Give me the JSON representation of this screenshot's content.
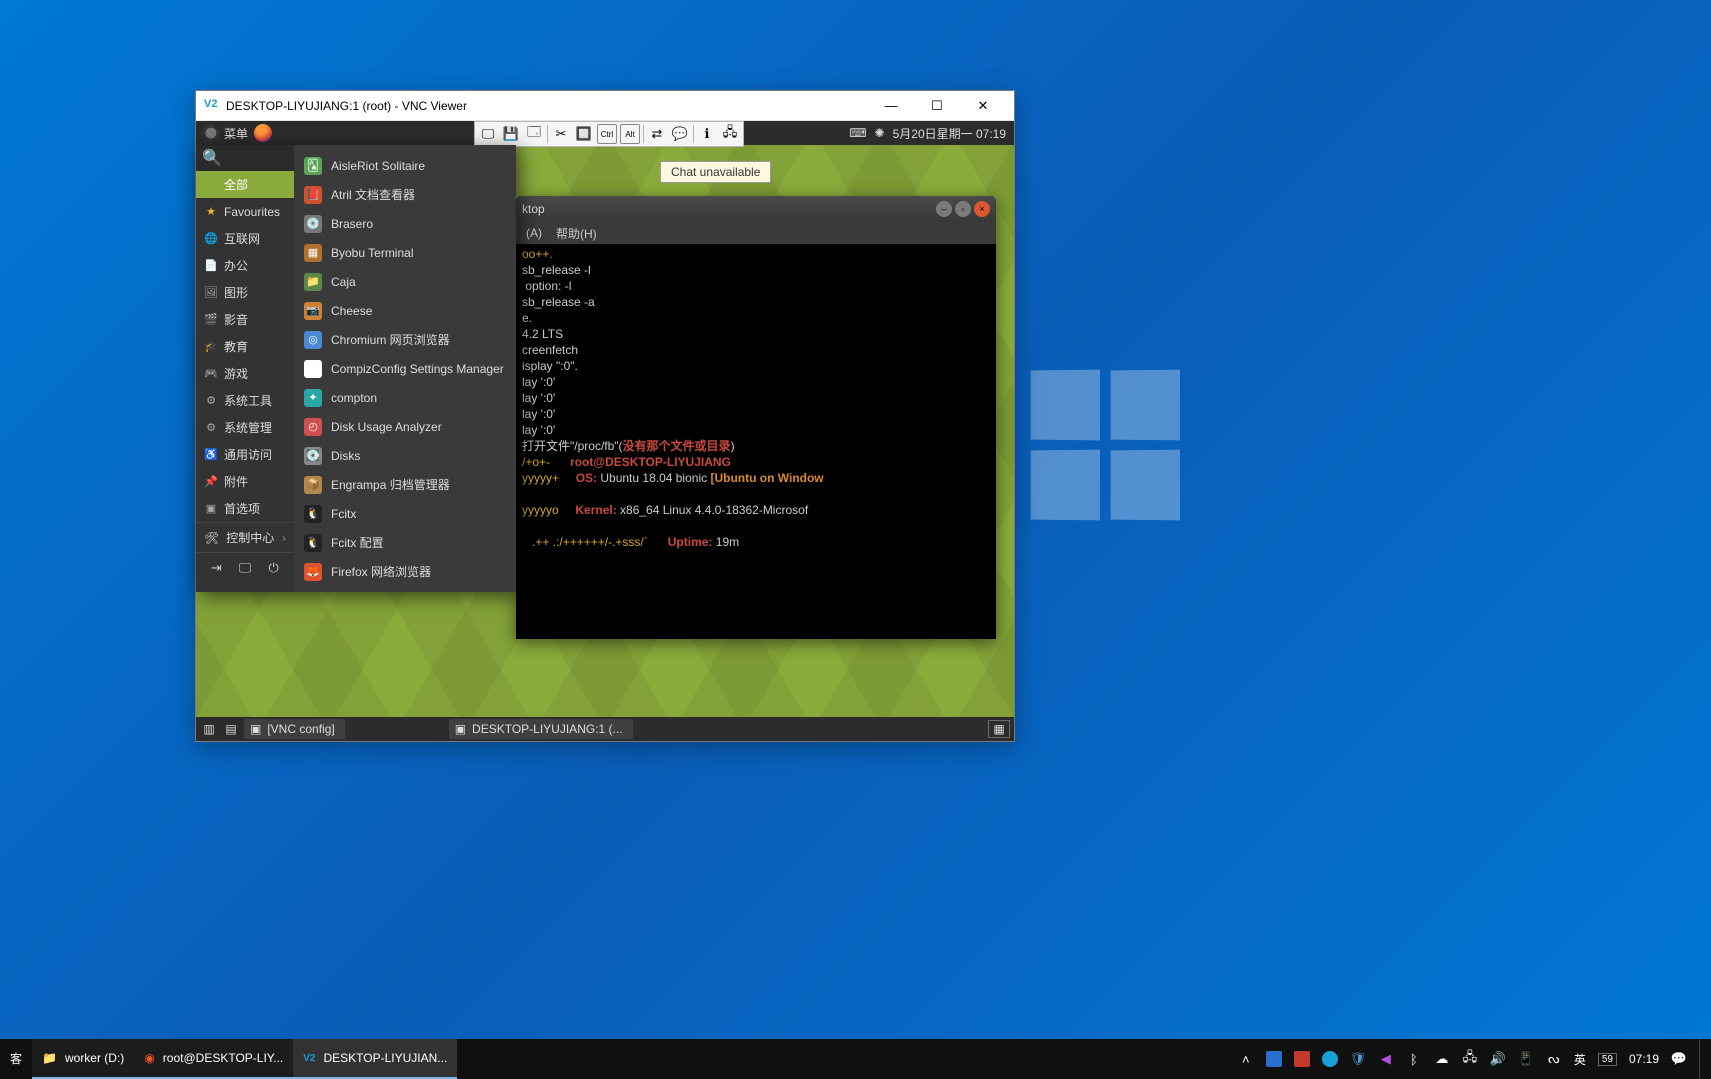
{
  "vnc": {
    "title": "DESKTOP-LIYUJIANG:1 (root) - VNC Viewer",
    "tooltip": "Chat unavailable"
  },
  "mate_panel": {
    "menu_label": "菜单",
    "clock": "5月20日星期一 07:19"
  },
  "app_menu": {
    "search_placeholder": "",
    "categories": [
      {
        "icon": "★",
        "label": "全部",
        "active": true,
        "color": "#8aaa3b"
      },
      {
        "icon": "★",
        "label": "Favourites",
        "color": "#f0b62a"
      },
      {
        "icon": "🌐",
        "label": "互联网"
      },
      {
        "icon": "📄",
        "label": "办公"
      },
      {
        "icon": "🖼",
        "label": "图形"
      },
      {
        "icon": "🎬",
        "label": "影音"
      },
      {
        "icon": "🎓",
        "label": "教育"
      },
      {
        "icon": "🎮",
        "label": "游戏"
      },
      {
        "icon": "⚙",
        "label": "系统工具"
      },
      {
        "icon": "⚙",
        "label": "系统管理"
      },
      {
        "icon": "♿",
        "label": "通用访问"
      },
      {
        "icon": "📌",
        "label": "附件"
      },
      {
        "icon": "▣",
        "label": "首选项"
      }
    ],
    "extra": {
      "icon": "🛠",
      "label": "控制中心"
    },
    "apps": [
      {
        "icon": "🂡",
        "bg": "#5aa558",
        "label": "AisleRiot Solitaire"
      },
      {
        "icon": "📕",
        "bg": "#d05030",
        "label": "Atril 文档查看器"
      },
      {
        "icon": "💿",
        "bg": "#777",
        "label": "Brasero"
      },
      {
        "icon": "▦",
        "bg": "#b07030",
        "label": "Byobu Terminal"
      },
      {
        "icon": "📁",
        "bg": "#5a8a48",
        "label": "Caja"
      },
      {
        "icon": "📷",
        "bg": "#d08030",
        "label": "Cheese"
      },
      {
        "icon": "◎",
        "bg": "#4a88d8",
        "label": "Chromium 网页浏览器"
      },
      {
        "icon": "⚙",
        "bg": "#ffffff",
        "label": "CompizConfig Settings Manager"
      },
      {
        "icon": "✦",
        "bg": "#2aa8a8",
        "label": "compton"
      },
      {
        "icon": "◴",
        "bg": "#d05050",
        "label": "Disk Usage Analyzer"
      },
      {
        "icon": "💽",
        "bg": "#888",
        "label": "Disks"
      },
      {
        "icon": "📦",
        "bg": "#b08848",
        "label": "Engrampa 归档管理器"
      },
      {
        "icon": "🐧",
        "bg": "#232323",
        "label": "Fcitx"
      },
      {
        "icon": "🐧",
        "bg": "#232323",
        "label": "Fcitx 配置"
      },
      {
        "icon": "🦊",
        "bg": "#e3502d",
        "label": "Firefox 网络浏览器"
      }
    ]
  },
  "terminal": {
    "title": "ktop",
    "menus": [
      "(A)",
      "帮助(H)"
    ],
    "lines": [
      {
        "cls": "term-yel",
        "text": "oo++."
      },
      {
        "cls": "",
        "text": "sb_release -l"
      },
      {
        "cls": "",
        "text": ""
      },
      {
        "cls": "",
        "text": ""
      },
      {
        "cls": "",
        "text": " option: -l"
      },
      {
        "cls": "",
        "text": "sb_release -a"
      },
      {
        "cls": "",
        "text": "e."
      },
      {
        "cls": "",
        "text": ""
      },
      {
        "cls": "",
        "text": "4.2 LTS"
      },
      {
        "cls": "",
        "text": ""
      },
      {
        "cls": "",
        "text": ""
      },
      {
        "cls": "",
        "text": "creenfetch"
      },
      {
        "cls": "",
        "text": "isplay \":0\"."
      },
      {
        "cls": "",
        "text": "lay ':0'"
      },
      {
        "cls": "",
        "text": "lay ':0'"
      },
      {
        "cls": "",
        "text": "lay ':0'"
      },
      {
        "cls": "",
        "text": "lay ':0'"
      }
    ],
    "proc_line_pre": "打开文件\"/proc/fb\"(",
    "proc_line_red": "没有那个文件或目录",
    "proc_line_post": ")",
    "sys_lines": [
      {
        "sym": "/+o+-",
        "key": "",
        "val_red": "root",
        "at": "@",
        "host": "DESKTOP-LIYUJIANG"
      },
      {
        "sym": "yyyyy+",
        "key": "OS:",
        "val": " Ubuntu 18.04 bionic ",
        "bracket": "[Ubuntu on Window"
      },
      {
        "sym": "",
        "key": "",
        "val": ""
      },
      {
        "sym": "yyyyyo",
        "key": "Kernel:",
        "val": " x86_64 Linux 4.4.0-18362-Microsof"
      },
      {
        "sym": "",
        "key": "",
        "val": ""
      }
    ],
    "uptime_sym": ".++ .:/++++++/-.+sss/`",
    "uptime_key": "Uptime:",
    "uptime_val": " 19m"
  },
  "mate_taskbar": {
    "items": [
      {
        "icon": "▣",
        "label": "[VNC config]"
      },
      {
        "icon": "▣",
        "label": "DESKTOP-LIYUJIANG:1 (..."
      }
    ]
  },
  "win_taskbar": {
    "label_guest": "客",
    "items": [
      {
        "icon": "📁",
        "label": "worker (D:)"
      },
      {
        "icon": "🟠",
        "label": "root@DESKTOP-LIY..."
      },
      {
        "icon": "V2",
        "label": "DESKTOP-LIYUJIAN..."
      }
    ],
    "tray": {
      "ime1": "英",
      "ime2": "59",
      "time": "07:19"
    }
  }
}
